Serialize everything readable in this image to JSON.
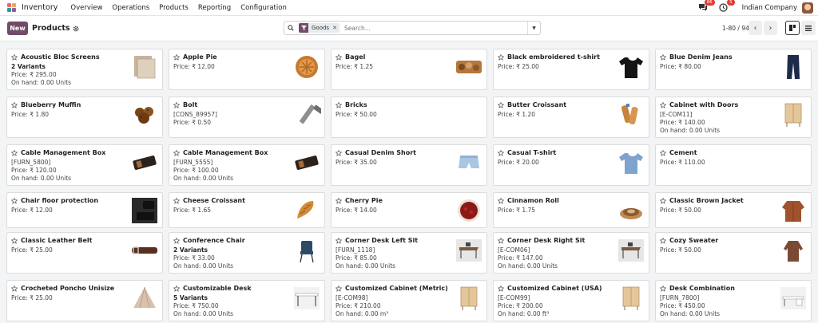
{
  "nav": {
    "app_title": "Inventory",
    "menu": [
      "Overview",
      "Operations",
      "Products",
      "Reporting",
      "Configuration"
    ],
    "messages_badge": "86",
    "activity_badge": "5",
    "company": "Indian Company"
  },
  "control": {
    "new_label": "New",
    "breadcrumb": "Products",
    "facet_label": "Goods",
    "search_placeholder": "Search...",
    "pager": "1-80 / 94"
  },
  "colors": {
    "brand": "#714b67",
    "badge": "#e53935",
    "active_view": "#1f1f1f"
  },
  "products": [
    {
      "name": "Acoustic Bloc Screens",
      "variants": "2 Variants",
      "price": "Price: ₹ 295.00",
      "onhand": "On hand: 0.00 Units",
      "icon": "acoustic-screen"
    },
    {
      "name": "Apple Pie",
      "price": "Price: ₹ 12.00",
      "icon": "apple-pie"
    },
    {
      "name": "Bagel",
      "price": "Price: ₹ 1.25",
      "icon": "bagel"
    },
    {
      "name": "Black embroidered t-shirt",
      "price": "Price: ₹ 25.00",
      "icon": "black-tshirt"
    },
    {
      "name": "Blue Denim Jeans",
      "price": "Price: ₹ 80.00",
      "icon": "jeans"
    },
    {
      "name": "Blueberry Muffin",
      "price": "Price: ₹ 1.80",
      "icon": "muffin"
    },
    {
      "name": "Bolt",
      "ref": "[CONS_89957]",
      "price": "Price: ₹ 0.50",
      "icon": "bolt"
    },
    {
      "name": "Bricks",
      "price": "Price: ₹ 50.00",
      "icon": "none"
    },
    {
      "name": "Butter Croissant",
      "price": "Price: ₹ 1.20",
      "icon": "butter-croissant"
    },
    {
      "name": "Cabinet with Doors",
      "ref": "[E-COM11]",
      "price": "Price: ₹ 140.00",
      "onhand": "On hand: 0.00 Units",
      "icon": "cabinet"
    },
    {
      "name": "Cable Management Box",
      "ref": "[FURN_5800]",
      "price": "Price: ₹ 120.00",
      "onhand": "On hand: 0.00 Units",
      "icon": "cable-box"
    },
    {
      "name": "Cable Management Box",
      "ref": "[FURN_5555]",
      "price": "Price: ₹ 100.00",
      "onhand": "On hand: 0.00 Units",
      "icon": "cable-box"
    },
    {
      "name": "Casual Denim Short",
      "price": "Price: ₹ 35.00",
      "icon": "denim-short"
    },
    {
      "name": "Casual T-shirt",
      "price": "Price: ₹ 20.00",
      "icon": "blue-tshirt"
    },
    {
      "name": "Cement",
      "price": "Price: ₹ 110.00",
      "icon": "none"
    },
    {
      "name": "Chair floor protection",
      "price": "Price: ₹ 12.00",
      "icon": "floor-protection"
    },
    {
      "name": "Cheese Croissant",
      "price": "Price: ₹ 1.65",
      "icon": "croissant"
    },
    {
      "name": "Cherry Pie",
      "price": "Price: ₹ 14.00",
      "icon": "cherry-pie"
    },
    {
      "name": "Cinnamon Roll",
      "price": "Price: ₹ 1.75",
      "icon": "cinnamon-roll"
    },
    {
      "name": "Classic Brown Jacket",
      "price": "Price: ₹ 50.00",
      "icon": "brown-jacket"
    },
    {
      "name": "Classic Leather Belt",
      "price": "Price: ₹ 25.00",
      "icon": "belt"
    },
    {
      "name": "Conference Chair",
      "variants": "2 Variants",
      "price": "Price: ₹ 33.00",
      "onhand": "On hand: 0.00 Units",
      "icon": "chair"
    },
    {
      "name": "Corner Desk Left Sit",
      "ref": "[FURN_1118]",
      "price": "Price: ₹ 85.00",
      "onhand": "On hand: 0.00 Units",
      "icon": "corner-desk"
    },
    {
      "name": "Corner Desk Right Sit",
      "ref": "[E-COM06]",
      "price": "Price: ₹ 147.00",
      "onhand": "On hand: 0.00 Units",
      "icon": "corner-desk"
    },
    {
      "name": "Cozy Sweater",
      "price": "Price: ₹ 50.00",
      "icon": "sweater"
    },
    {
      "name": "Crocheted Poncho Unisize",
      "price": "Price: ₹ 25.00",
      "icon": "poncho"
    },
    {
      "name": "Customizable Desk",
      "variants": "5 Variants",
      "price": "Price: ₹ 750.00",
      "onhand": "On hand: 0.00 Units",
      "icon": "desk"
    },
    {
      "name": "Customized Cabinet (Metric)",
      "ref": "[E-COM98]",
      "price": "Price: ₹ 210.00",
      "onhand": "On hand: 0.00 m³",
      "icon": "cabinet"
    },
    {
      "name": "Customized Cabinet (USA)",
      "ref": "[E-COM99]",
      "price": "Price: ₹ 200.00",
      "onhand": "On hand: 0.00 ft³",
      "icon": "cabinet"
    },
    {
      "name": "Desk Combination",
      "ref": "[FURN_7800]",
      "price": "Price: ₹ 450.00",
      "onhand": "On hand: 0.00 Units",
      "icon": "desk-combination"
    }
  ]
}
